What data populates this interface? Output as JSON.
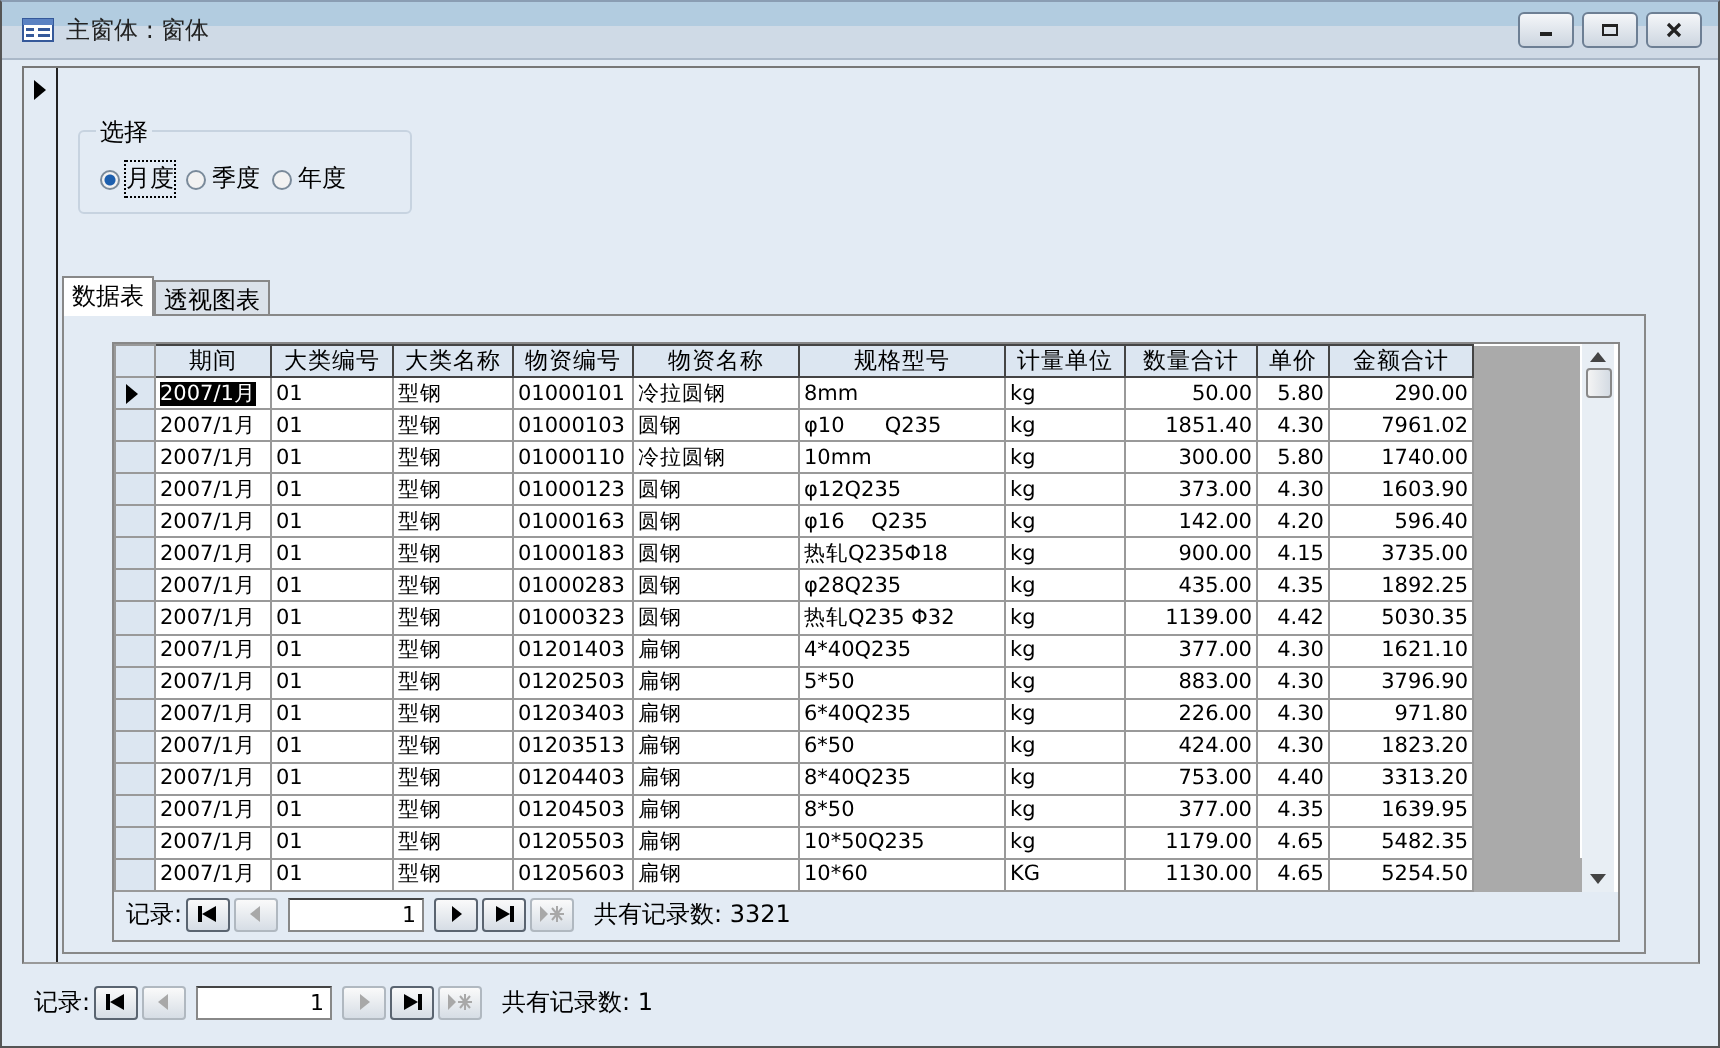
{
  "window": {
    "title": "主窗体 : 窗体"
  },
  "option_group": {
    "label": "选择",
    "options": [
      {
        "label": "月度",
        "selected": true
      },
      {
        "label": "季度",
        "selected": false
      },
      {
        "label": "年度",
        "selected": false
      }
    ]
  },
  "tabs": [
    {
      "label": "数据表",
      "selected": true
    },
    {
      "label": "透视图表",
      "selected": false
    }
  ],
  "table": {
    "columns": [
      {
        "label": "期间"
      },
      {
        "label": "大类编号"
      },
      {
        "label": "大类名称"
      },
      {
        "label": "物资编号"
      },
      {
        "label": "物资名称"
      },
      {
        "label": "规格型号"
      },
      {
        "label": "计量单位"
      },
      {
        "label": "数量合计"
      },
      {
        "label": "单价"
      },
      {
        "label": "金额合计"
      }
    ],
    "rows": [
      {
        "selected": true,
        "cells": [
          "2007/1月",
          "01",
          "型钢",
          "01000101",
          "冷拉圆钢",
          "8mm",
          "kg",
          "50.00",
          "5.80",
          "290.00"
        ]
      },
      {
        "selected": false,
        "cells": [
          "2007/1月",
          "01",
          "型钢",
          "01000103",
          "圆钢",
          "φ10      Q235",
          "kg",
          "1851.40",
          "4.30",
          "7961.02"
        ]
      },
      {
        "selected": false,
        "cells": [
          "2007/1月",
          "01",
          "型钢",
          "01000110",
          "冷拉圆钢",
          "10mm",
          "kg",
          "300.00",
          "5.80",
          "1740.00"
        ]
      },
      {
        "selected": false,
        "cells": [
          "2007/1月",
          "01",
          "型钢",
          "01000123",
          "圆钢",
          "φ12Q235",
          "kg",
          "373.00",
          "4.30",
          "1603.90"
        ]
      },
      {
        "selected": false,
        "cells": [
          "2007/1月",
          "01",
          "型钢",
          "01000163",
          "圆钢",
          "φ16    Q235",
          "kg",
          "142.00",
          "4.20",
          "596.40"
        ]
      },
      {
        "selected": false,
        "cells": [
          "2007/1月",
          "01",
          "型钢",
          "01000183",
          "圆钢",
          "热轧Q235Φ18",
          "kg",
          "900.00",
          "4.15",
          "3735.00"
        ]
      },
      {
        "selected": false,
        "cells": [
          "2007/1月",
          "01",
          "型钢",
          "01000283",
          "圆钢",
          "φ28Q235",
          "kg",
          "435.00",
          "4.35",
          "1892.25"
        ]
      },
      {
        "selected": false,
        "cells": [
          "2007/1月",
          "01",
          "型钢",
          "01000323",
          "圆钢",
          "热轧Q235 Φ32",
          "kg",
          "1139.00",
          "4.42",
          "5030.35"
        ]
      },
      {
        "selected": false,
        "cells": [
          "2007/1月",
          "01",
          "型钢",
          "01201403",
          "扁钢",
          "4*40Q235",
          "kg",
          "377.00",
          "4.30",
          "1621.10"
        ]
      },
      {
        "selected": false,
        "cells": [
          "2007/1月",
          "01",
          "型钢",
          "01202503",
          "扁钢",
          "5*50",
          "kg",
          "883.00",
          "4.30",
          "3796.90"
        ]
      },
      {
        "selected": false,
        "cells": [
          "2007/1月",
          "01",
          "型钢",
          "01203403",
          "扁钢",
          "6*40Q235",
          "kg",
          "226.00",
          "4.30",
          "971.80"
        ]
      },
      {
        "selected": false,
        "cells": [
          "2007/1月",
          "01",
          "型钢",
          "01203513",
          "扁钢",
          "6*50",
          "kg",
          "424.00",
          "4.30",
          "1823.20"
        ]
      },
      {
        "selected": false,
        "cells": [
          "2007/1月",
          "01",
          "型钢",
          "01204403",
          "扁钢",
          "8*40Q235",
          "kg",
          "753.00",
          "4.40",
          "3313.20"
        ]
      },
      {
        "selected": false,
        "cells": [
          "2007/1月",
          "01",
          "型钢",
          "01204503",
          "扁钢",
          "8*50",
          "kg",
          "377.00",
          "4.35",
          "1639.95"
        ]
      },
      {
        "selected": false,
        "cells": [
          "2007/1月",
          "01",
          "型钢",
          "01205503",
          "扁钢",
          "10*50Q235",
          "kg",
          "1179.00",
          "4.65",
          "5482.35"
        ]
      },
      {
        "selected": false,
        "cells": [
          "2007/1月",
          "01",
          "型钢",
          "01205603",
          "扁钢",
          "10*60",
          "KG",
          "1130.00",
          "4.65",
          "5254.50"
        ]
      }
    ]
  },
  "inner_navigator": {
    "label": "记录:",
    "value": "1",
    "total": "共有记录数: 3321",
    "buttons": [
      {
        "kind": "first",
        "disabled": false
      },
      {
        "kind": "prev",
        "disabled": true
      },
      {
        "kind": "next",
        "disabled": false
      },
      {
        "kind": "last",
        "disabled": false
      },
      {
        "kind": "new",
        "disabled": true
      }
    ]
  },
  "form_navigator": {
    "label": "记录:",
    "value": "1",
    "total": "共有记录数: 1",
    "buttons": [
      {
        "kind": "first",
        "disabled": false
      },
      {
        "kind": "prev",
        "disabled": true
      },
      {
        "kind": "next",
        "disabled": true
      },
      {
        "kind": "last",
        "disabled": false
      },
      {
        "kind": "new",
        "disabled": true
      }
    ]
  }
}
